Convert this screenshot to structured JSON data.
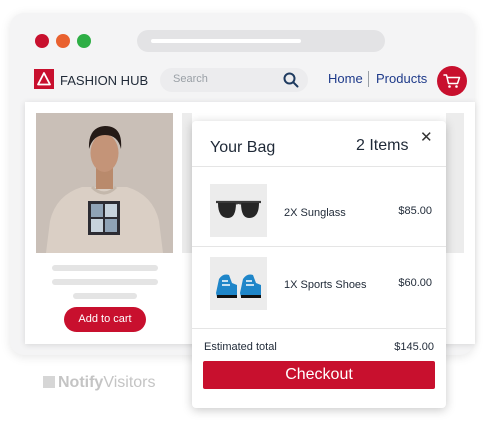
{
  "window": {
    "controls": [
      "close",
      "minimize",
      "maximize"
    ],
    "colors": {
      "close": "#c8102e",
      "minimize": "#e9612f",
      "maximize": "#2eae45"
    }
  },
  "header": {
    "brand": "FASHION HUB",
    "logo_icon": "triangle-logo-icon",
    "search": {
      "placeholder": "Search",
      "icon": "search-icon"
    },
    "nav": {
      "home": "Home",
      "products": "Products"
    },
    "cart_icon": "cart-icon",
    "accent_color": "#c8102e"
  },
  "product": {
    "add_to_cart": "Add to cart",
    "image": "man-in-beige-tshirt-photo"
  },
  "bag": {
    "title": "Your Bag",
    "count": "2 Items",
    "close_icon": "close-icon",
    "items": [
      {
        "name": "2X Sunglass",
        "price": "$85.00",
        "icon": "sunglasses-icon"
      },
      {
        "name": "1X Sports Shoes",
        "price": "$60.00",
        "icon": "sports-shoes-icon"
      }
    ],
    "estimated_total_label": "Estimated total",
    "estimated_total_value": "$145.00",
    "checkout_label": "Checkout"
  },
  "watermark": {
    "part1": "Notify",
    "part2": "Visitors"
  }
}
